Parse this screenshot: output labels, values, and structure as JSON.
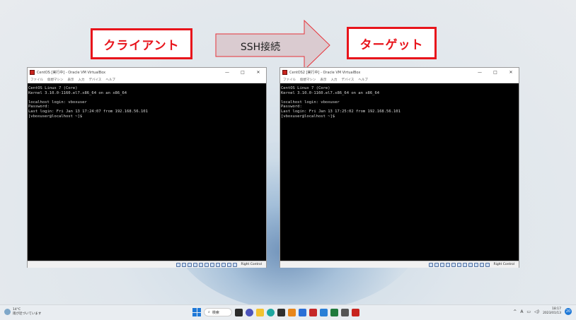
{
  "annotations": {
    "client_label": "クライアント",
    "target_label": "ターゲット",
    "arrow_label": "SSH接続"
  },
  "vm_client": {
    "title": "CentOS [実行中] - Oracle VM VirtualBox",
    "menu": [
      "ファイル",
      "仮想マシン",
      "表示",
      "入力",
      "デバイス",
      "ヘルプ"
    ],
    "console": "CentOS Linux 7 (Core)\nKernel 3.10.0-1160.el7.x86_64 on an x86_64\n\nlocalhost login: vboxuser\nPassword:\nLast login: Fri Jan 13 17:24:07 from 192.168.56.101\n[vboxuser@localhost ~]$",
    "host_key": "Right Control"
  },
  "vm_target": {
    "title": "CentOS2 [実行中] - Oracle VM VirtualBox",
    "menu": [
      "ファイル",
      "仮想マシン",
      "表示",
      "入力",
      "デバイス",
      "ヘルプ"
    ],
    "console": "CentOS Linux 7 (Core)\nKernel 3.10.0-1160.el7.x86_64 on an x86_64\n\nlocalhost login: vboxuser\nPassword:\nLast login: Fri Jan 13 17:25:02 from 192.168.56.101\n[vboxuser@localhost ~]$",
    "host_key": "Right Control"
  },
  "window_controls": {
    "minimize": "—",
    "maximize": "□",
    "close": "✕"
  },
  "taskbar": {
    "weather_temp": "14°C",
    "weather_text": "雨が近づいています",
    "search_label": "検索",
    "tray_chevron": "^",
    "ime": "A",
    "time": "18:17",
    "date": "2023/01/13",
    "notification_count": "20"
  },
  "colors": {
    "annotation_red": "#e8141b",
    "console_bg": "#000000",
    "console_text": "#d7d7d7",
    "accent": "#1e78d7"
  }
}
